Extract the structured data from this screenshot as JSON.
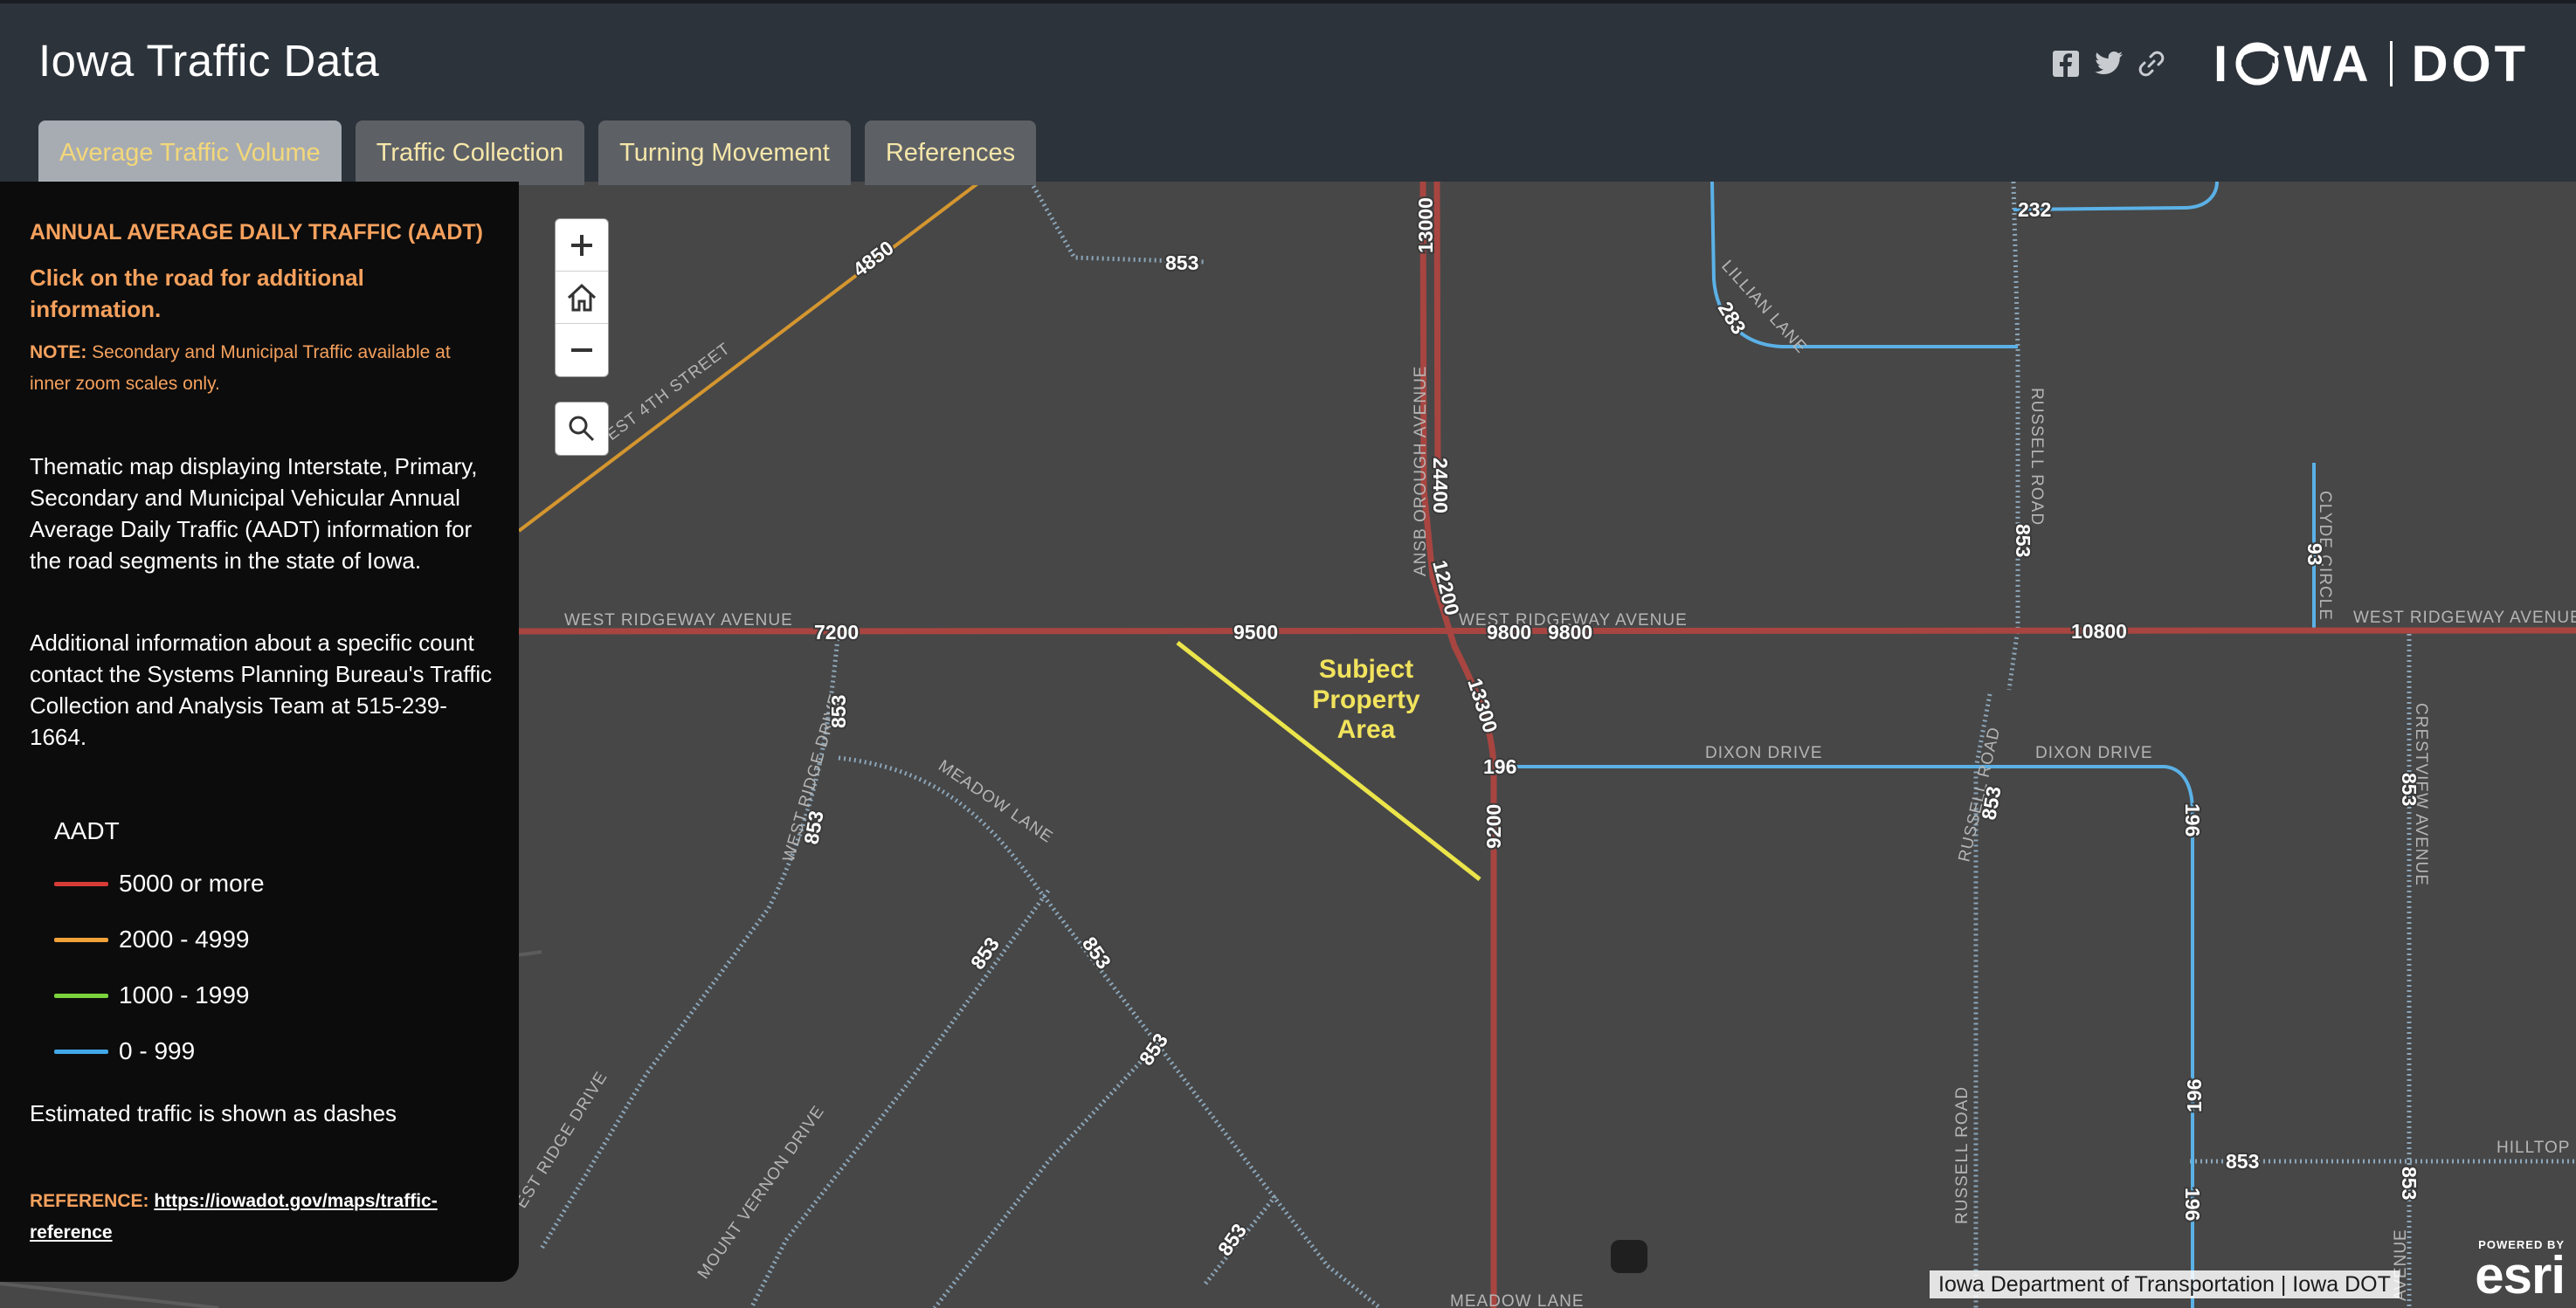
{
  "header": {
    "title": "Iowa Traffic Data",
    "brand_left": "IOWA",
    "brand_right": "DOT",
    "share_icons": [
      "facebook-icon",
      "twitter-icon",
      "link-icon"
    ]
  },
  "tabs": [
    {
      "label": "Average Traffic Volume",
      "active": true
    },
    {
      "label": "Traffic Collection",
      "active": false
    },
    {
      "label": "Turning Movement",
      "active": false
    },
    {
      "label": "References",
      "active": false
    }
  ],
  "panel": {
    "heading": "ANNUAL AVERAGE DAILY TRAFFIC (AADT)",
    "click_instruction": "Click on the road for additional information.",
    "note_label": "NOTE:",
    "note_text": "Secondary and Municipal Traffic available at inner zoom scales only.",
    "description": "Thematic map displaying Interstate, Primary, Secondary and Municipal Vehicular Annual Average Daily Traffic (AADT) information for the road segments in the state of Iowa.",
    "contact": "Additional information about a specific count contact the Systems Planning Bureau's Traffic Collection and Analysis Team at 515-239-1664.",
    "legend_title": "AADT",
    "legend": [
      {
        "label": "5000 or more",
        "color": "#d63b35"
      },
      {
        "label": "2000 - 4999",
        "color": "#f2a23a"
      },
      {
        "label": "1000 - 1999",
        "color": "#7bd43c"
      },
      {
        "label": "0 - 999",
        "color": "#43a8e8"
      }
    ],
    "dashes_note": "Estimated traffic is shown as dashes",
    "reference_label": "REFERENCE:",
    "reference_link": "https://iowadot.gov/maps/traffic-reference"
  },
  "map": {
    "controls": {
      "zoom_in": "+",
      "zoom_out": "−"
    },
    "colors": {
      "high_volume": "#a84540",
      "medium_volume": "#d4962f",
      "low_volume": "#5bb1e6",
      "estimated": "#6fa4c4",
      "subject": "#ece54a"
    },
    "street_names": {
      "w_ridgeway_1": "WEST RIDGEWAY AVENUE",
      "w_ridgeway_2": "WEST RIDGEWAY AVENUE",
      "w_ridgeway_3": "WEST RIDGEWAY AVENUE",
      "w_4th": "EST 4TH STREET",
      "ansborough": "ANSB OROUGH AVENUE",
      "lillian": "LILLIAN LANE",
      "russell_1": "RUSSELL ROAD",
      "russell_2": "RUSSELL ROAD",
      "russell_3": "RUSSELL ROAD",
      "clyde": "CLYDE CIRCLE",
      "dixon_1": "DIXON DRIVE",
      "dixon_2": "DIXON DRIVE",
      "crestview": "CRESTVIEW AVENUE",
      "west_ridge_1": "WEST RIDGE DRIVE",
      "west_ridge_2": "EST RIDGE DRIVE",
      "meadow_1": "MEADOW LANE",
      "meadow_2": "MEADOW LANE",
      "mount_vernon": "MOUNT VERNON DRIVE",
      "hilltop": "HILLTOP R",
      "avenue_frag": "AVENUE"
    },
    "volumes": {
      "v4850": "4850",
      "v853_top": "853",
      "v13000": "13000",
      "v232": "232",
      "v283": "283",
      "v24400": "24400",
      "v12200": "12200",
      "v853_russell_top": "853",
      "v93": "93",
      "v7200": "7200",
      "v9500": "9500",
      "v9800_a": "9800",
      "v9800_b": "9800",
      "v10800": "10800",
      "v13300": "13300",
      "v196_a": "196",
      "v9200": "9200",
      "v853_wr": "853",
      "v853_wr2": "853",
      "v853_russell": "853",
      "v196_b": "196",
      "v853_crest": "853",
      "v853_ml1": "853",
      "v853_ml2": "853",
      "v853_ml3": "853",
      "v853_ml4": "853",
      "v196_c": "196",
      "v853_hill": "853",
      "v196_d": "196",
      "v853_crest2": "853"
    },
    "subject_area": [
      "Subject",
      "Property",
      "Area"
    ],
    "attribution": "Iowa Department of Transportation | Iowa DOT",
    "esri_powered": "POWERED BY",
    "esri_logo": "esri"
  }
}
